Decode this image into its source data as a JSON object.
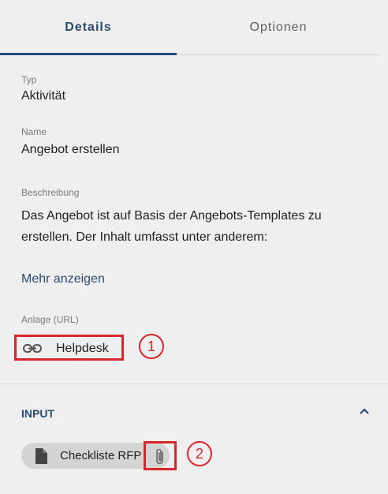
{
  "tabs": [
    {
      "label": "Details",
      "active": true
    },
    {
      "label": "Optionen",
      "active": false
    }
  ],
  "fields": {
    "typ": {
      "label": "Typ",
      "value": "Aktivität"
    },
    "name": {
      "label": "Name",
      "value": "Angebot erstellen"
    },
    "beschreibung": {
      "label": "Beschreibung",
      "value": "Das Angebot ist auf Basis der Angebots-Templates zu erstellen. Der Inhalt umfasst unter anderem:"
    },
    "more_link": "Mehr anzeigen",
    "anlage": {
      "label": "Anlage (URL)",
      "link_label": "Helpdesk",
      "icon": "link-icon"
    }
  },
  "input_section": {
    "title": "INPUT",
    "collapse_icon": "chevron-up-icon",
    "file": {
      "label": "Checkliste RFP",
      "icon": "document-icon",
      "attach_icon": "paperclip-icon"
    }
  },
  "callouts": [
    "1",
    "2"
  ],
  "colors": {
    "accent": "#1e4a7e",
    "highlight": "#d9262c",
    "background": "#efefef",
    "chip": "#d4d4d4"
  }
}
